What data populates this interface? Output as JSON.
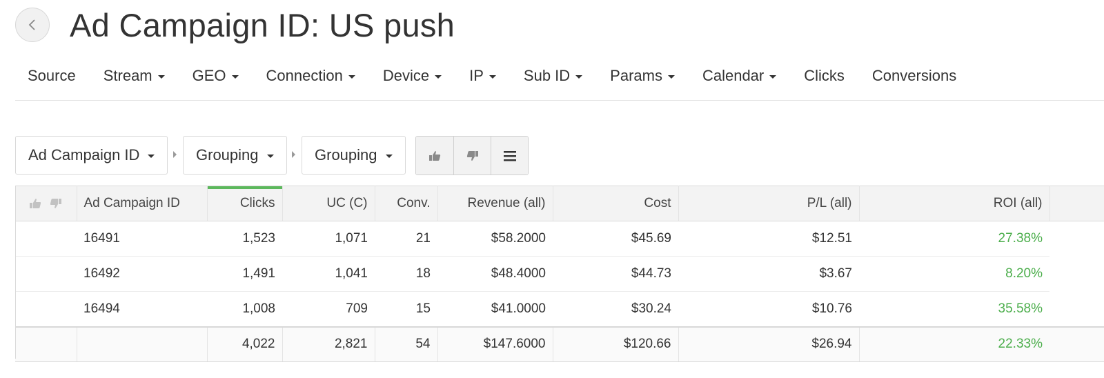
{
  "header": {
    "back_icon": "chevron-left-icon",
    "title": "Ad Campaign ID: US push"
  },
  "nav": {
    "items": [
      {
        "label": "Source",
        "dropdown": false
      },
      {
        "label": "Stream",
        "dropdown": true
      },
      {
        "label": "GEO",
        "dropdown": true
      },
      {
        "label": "Connection",
        "dropdown": true
      },
      {
        "label": "Device",
        "dropdown": true
      },
      {
        "label": "IP",
        "dropdown": true
      },
      {
        "label": "Sub ID",
        "dropdown": true
      },
      {
        "label": "Params",
        "dropdown": true
      },
      {
        "label": "Calendar",
        "dropdown": true
      },
      {
        "label": "Clicks",
        "dropdown": false
      },
      {
        "label": "Conversions",
        "dropdown": false
      }
    ]
  },
  "grouping": {
    "level1": "Ad Campaign ID",
    "level2": "Grouping",
    "level3": "Grouping",
    "tools": [
      "thumbs-up-icon",
      "thumbs-down-icon",
      "menu-icon"
    ]
  },
  "table": {
    "columns": [
      "Ad Campaign ID",
      "Clicks",
      "UC (C)",
      "Conv.",
      "Revenue (all)",
      "Cost",
      "P/L (all)",
      "ROI (all)"
    ],
    "sorted_column": "Clicks",
    "rows": [
      {
        "id": "16491",
        "clicks": "1,523",
        "uc": "1,071",
        "conv": "21",
        "revenue": "$58.2000",
        "cost": "$45.69",
        "pl": "$12.51",
        "roi": "27.38%"
      },
      {
        "id": "16492",
        "clicks": "1,491",
        "uc": "1,041",
        "conv": "18",
        "revenue": "$48.4000",
        "cost": "$44.73",
        "pl": "$3.67",
        "roi": "8.20%"
      },
      {
        "id": "16494",
        "clicks": "1,008",
        "uc": "709",
        "conv": "15",
        "revenue": "$41.0000",
        "cost": "$30.24",
        "pl": "$10.76",
        "roi": "35.58%"
      }
    ],
    "total": {
      "clicks": "4,022",
      "uc": "2,821",
      "conv": "54",
      "revenue": "$147.6000",
      "cost": "$120.66",
      "pl": "$26.94",
      "roi": "22.33%"
    }
  },
  "colors": {
    "accent_green": "#5cb85c",
    "roi_text": "#4cae4c"
  }
}
